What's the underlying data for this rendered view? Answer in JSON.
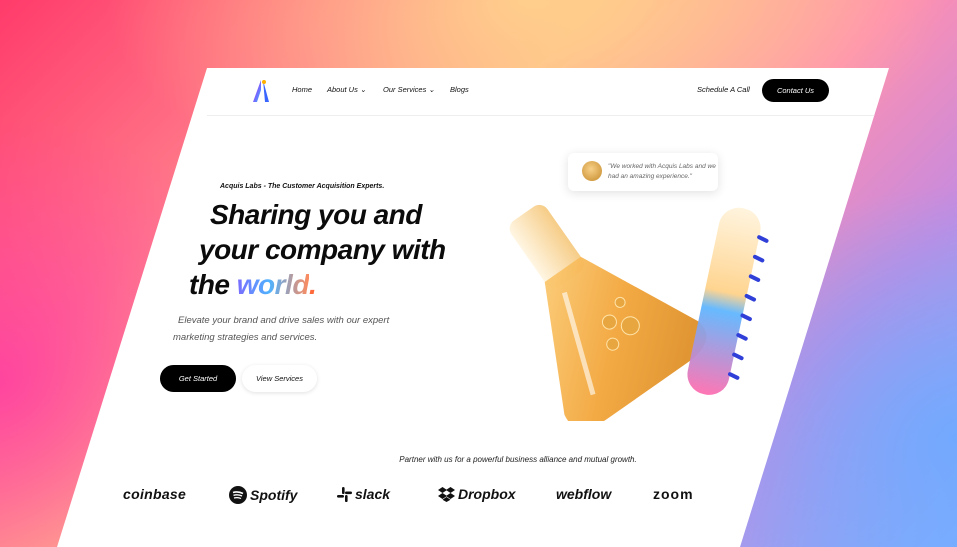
{
  "nav": {
    "items": [
      "Home",
      "About Us",
      "Our Services",
      "Blogs"
    ],
    "schedule": "Schedule A Call",
    "contact": "Contact Us"
  },
  "hero": {
    "tagline": "Acquis Labs - The Customer Acquisition Experts.",
    "line1": "Sharing you and",
    "line2": "your company with",
    "line3_prefix": "the ",
    "line3_highlight": "world",
    "line3_suffix": ".",
    "sub1": "Elevate your brand and drive sales with our expert",
    "sub2": "marketing strategies and services.",
    "get_started": "Get Started",
    "view_services": "View Services",
    "testimonial": "\"We worked with Acquis Labs and we had an amazing experience.\""
  },
  "partners": {
    "caption": "Partner with us for a powerful business alliance and mutual growth.",
    "logos": [
      "coinbase",
      "Spotify",
      "slack",
      "Dropbox",
      "webflow",
      "zoom"
    ]
  },
  "colors": {
    "accent_dark": "#000000",
    "highlight_start": "#7a6cff",
    "highlight_end": "#ff8a5c"
  },
  "icons": [
    "brand-logo-icon",
    "chevron-down-icon",
    "spotify-icon",
    "slack-icon",
    "dropbox-icon"
  ]
}
